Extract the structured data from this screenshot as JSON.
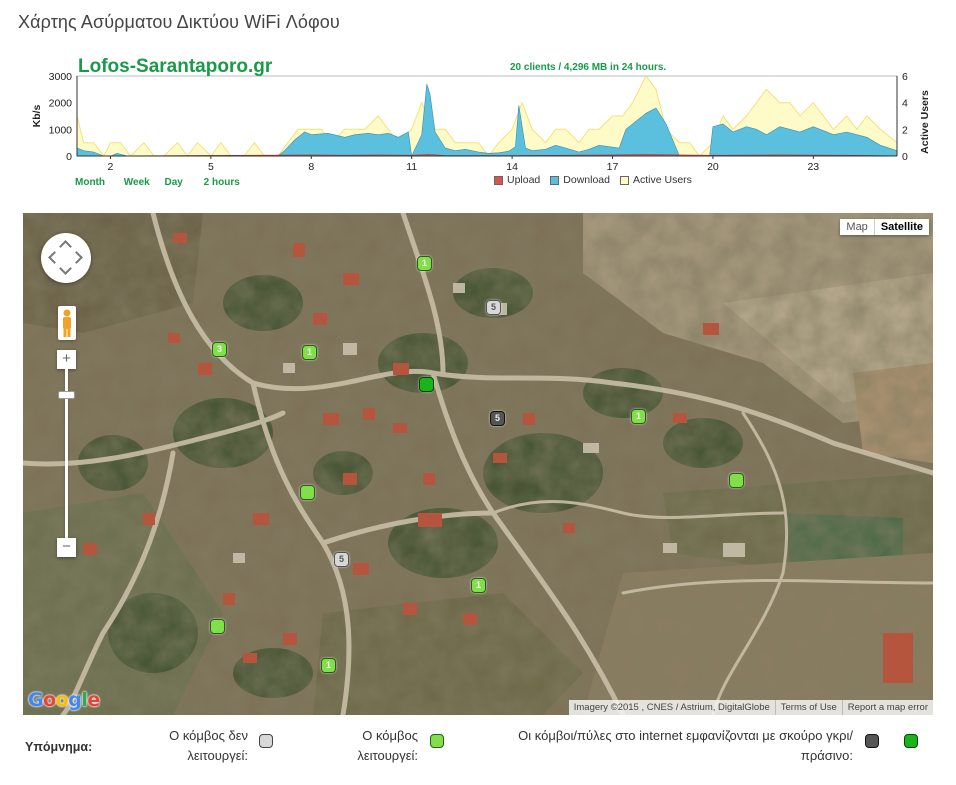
{
  "page": {
    "title": "Χάρτης Ασύρματου Δικτύου WiFi Λόφου"
  },
  "chart": {
    "site": "Lofos-Sarantaporo.gr",
    "summary": "20 clients / 4,296 MB in 24 hours.",
    "range_links": [
      "Month",
      "Week",
      "Day",
      "2 hours"
    ],
    "legend": [
      {
        "label": "Upload",
        "color": "#d9534f"
      },
      {
        "label": "Download",
        "color": "#5bc0de"
      },
      {
        "label": "Active Users",
        "color": "#fff9b0"
      }
    ]
  },
  "chart_data": {
    "type": "area",
    "ylabel": "Kb/s",
    "y2label": "Active Users",
    "ylim": [
      0,
      3000
    ],
    "y2lim": [
      0,
      6
    ],
    "yticks": [
      "3000",
      "2000",
      "1000",
      "0"
    ],
    "y2ticks": [
      "6",
      "4",
      "2",
      "0"
    ],
    "xticks": [
      "2",
      "5",
      "8",
      "11",
      "14",
      "17",
      "20",
      "23"
    ],
    "xrange": [
      1.0,
      25.5
    ],
    "colors": {
      "upload": "#d9534f",
      "download": "#5bc0de",
      "users_fill": "#fffbc8",
      "users_line": "#f2e27a"
    },
    "series": [
      {
        "name": "Download",
        "x": [
          1.0,
          1.2,
          1.5,
          1.8,
          2.0,
          2.2,
          2.5,
          3.0,
          3.5,
          4.0,
          4.5,
          5.0,
          5.5,
          6.0,
          6.5,
          7.0,
          7.2,
          7.5,
          7.8,
          8.0,
          8.5,
          9.0,
          9.3,
          9.7,
          10.0,
          10.3,
          10.6,
          10.9,
          11.0,
          11.3,
          11.45,
          11.55,
          11.7,
          12.0,
          12.3,
          12.6,
          13.0,
          13.3,
          13.6,
          13.9,
          14.1,
          14.2,
          14.4,
          14.6,
          15.0,
          15.3,
          15.6,
          16.0,
          16.3,
          16.6,
          16.9,
          17.2,
          17.4,
          17.7,
          18.0,
          18.3,
          18.6,
          19.0,
          19.3,
          19.6,
          19.9,
          20.0,
          20.3,
          20.6,
          21.0,
          21.3,
          21.6,
          22.0,
          22.3,
          22.6,
          23.0,
          23.3,
          23.6,
          24.0,
          24.3,
          24.6,
          25.0,
          25.5
        ],
        "values": [
          300,
          200,
          150,
          0,
          0,
          100,
          0,
          0,
          0,
          0,
          0,
          0,
          0,
          0,
          0,
          0,
          200,
          600,
          900,
          800,
          850,
          700,
          800,
          850,
          800,
          850,
          700,
          900,
          0,
          800,
          2700,
          2300,
          900,
          300,
          200,
          250,
          150,
          100,
          120,
          180,
          350,
          1900,
          300,
          200,
          250,
          400,
          300,
          150,
          250,
          400,
          350,
          300,
          1000,
          1300,
          1600,
          1800,
          1200,
          0,
          0,
          0,
          0,
          1100,
          1200,
          900,
          1100,
          1000,
          800,
          1100,
          1000,
          900,
          1100,
          950,
          800,
          900,
          800,
          700,
          400,
          200
        ]
      },
      {
        "name": "Upload",
        "x": [
          1.0,
          8.0,
          9.0,
          10.0,
          11.0,
          11.5,
          12.0,
          14.0,
          17.0,
          18.0,
          19.0,
          20.0,
          22.0,
          24.0,
          25.5
        ],
        "values": [
          0,
          40,
          30,
          40,
          30,
          60,
          20,
          20,
          40,
          60,
          40,
          30,
          40,
          30,
          10
        ]
      },
      {
        "name": "Active Users",
        "x": [
          1.0,
          1.2,
          1.5,
          1.8,
          2.0,
          2.3,
          2.6,
          3.0,
          3.3,
          3.6,
          4.0,
          4.3,
          4.6,
          5.0,
          5.3,
          5.6,
          6.0,
          6.3,
          6.6,
          7.0,
          7.3,
          7.6,
          8.0,
          8.3,
          8.6,
          9.0,
          9.3,
          9.6,
          10.0,
          10.3,
          10.6,
          11.0,
          11.3,
          11.6,
          12.0,
          12.3,
          12.6,
          13.0,
          13.3,
          13.6,
          14.0,
          14.3,
          14.6,
          15.0,
          15.3,
          15.6,
          16.0,
          16.3,
          16.6,
          17.0,
          17.3,
          17.6,
          18.0,
          18.3,
          18.6,
          19.0,
          19.3,
          19.6,
          20.0,
          20.3,
          20.6,
          21.0,
          21.3,
          21.6,
          22.0,
          22.3,
          22.6,
          23.0,
          23.3,
          23.6,
          24.0,
          24.3,
          24.6,
          25.0,
          25.5
        ],
        "values": [
          3,
          1,
          1,
          0,
          1,
          1,
          0,
          1,
          0,
          0,
          1,
          0,
          1,
          0,
          1,
          0,
          0,
          1,
          0,
          0,
          1,
          2,
          2,
          2,
          1,
          2,
          2,
          2,
          3,
          2,
          1,
          2,
          4,
          2,
          2,
          1,
          1,
          1,
          0,
          1,
          2,
          4,
          2,
          1,
          2,
          2,
          1,
          2,
          2,
          3,
          3,
          4,
          6,
          5,
          2,
          1,
          1,
          0,
          1,
          3,
          2,
          3,
          4,
          5,
          4,
          4,
          3,
          4,
          3,
          2,
          3,
          2,
          3,
          2,
          1
        ]
      }
    ]
  },
  "map": {
    "type_buttons": {
      "map": "Map",
      "satellite": "Satellite"
    },
    "zoom_in": "+",
    "zoom_out": "−",
    "google": "Google",
    "attribution": [
      "Imagery ©2015 , CNES / Astrium, DigitalGlobe",
      "Terms of Use",
      "Report a map error"
    ],
    "nodes": [
      {
        "label": "1",
        "status": "green"
      },
      {
        "label": "5",
        "status": "gray"
      },
      {
        "label": "3",
        "status": "green"
      },
      {
        "label": "1",
        "status": "green"
      },
      {
        "label": "",
        "status": "dgreen"
      },
      {
        "label": "5",
        "status": "dgray"
      },
      {
        "label": "1",
        "status": "green"
      },
      {
        "label": "",
        "status": "green"
      },
      {
        "label": "",
        "status": "green"
      },
      {
        "label": "5",
        "status": "gray"
      },
      {
        "label": "1",
        "status": "green"
      },
      {
        "label": "",
        "status": "green"
      },
      {
        "label": "1",
        "status": "green"
      }
    ]
  },
  "legend": {
    "title": "Υπόμνημα:",
    "down_line1": "Ο κόμβος δεν",
    "down_line2": "λειτουργεί:",
    "up_line1": "Ο κόμβος",
    "up_line2": "λειτουργεί:",
    "gw_line1": "Οι κόμβοι/πύλες στο internet εμφανίζονται με σκούρο γκρι/",
    "gw_line2": "πράσινο:"
  }
}
